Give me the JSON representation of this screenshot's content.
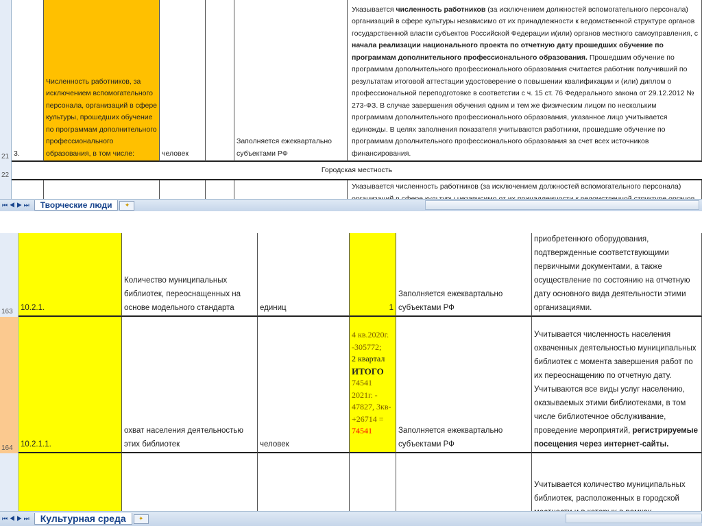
{
  "top": {
    "row21": {
      "num": "21",
      "code": "3.",
      "name": "Численность работников, за исключением вспомогательного персонала, организаций в сфере культуры, прошедших обучение по программам дополнительного профессионального образования, в том числе:",
      "unit": "человек",
      "fill": "Заполняется ежеквартально субъектами РФ",
      "desc_1": "Указывается ",
      "desc_b1": "численность работников",
      "desc_2": " (за исключением должностей вспомогательного персонала) организаций в сфере культуры независимо от их принадлежности к ведомственной структуре органов государственной власти субъектов Российской Федерации и(или) органов местного самоуправления, с ",
      "desc_b2": "начала реализации национального проекта по отчетную дату прошедших обучение по программам дополнительного профессионального образования.",
      "desc_3": " Прошедшим обучение по программам дополнительного профессионального образования считается работник получивший по результатам итоговой аттестации удостоверение о повышении квалификации и (или) диплом о профессиональной переподготовке в соответстии с ч. 15 ст. 76 Федерального закона от 29.12.2012 № 273-ФЗ. В случае завершения обучения одним и тем же физическим лицом по нескольким программам дополнительного профессионального образования, указанное лицо учитывается единожды. В целях заполнения показателя учитываются работники, прошедшие обучение по программам дополнительного профессионального образования за счет всех источников финансирования."
    },
    "row22": {
      "num": "22",
      "text": "Городская местность"
    },
    "row23": {
      "desc": "Указывается численность работников (за исключением должностей вспомогательного персонала) организаций в сфере культуры независимо от их принадлежности к ведомственной структуре органов"
    },
    "sheet_tab": "Творческие люди"
  },
  "bottom": {
    "row162": {
      "desc": "служит приемка выполненных работ и приобретенного оборудования, подтвержденные соответствующими первичными документами, а также осуществление по состоянию на отчетную дату основного вида деятельности этими организациями."
    },
    "row163": {
      "num": "163",
      "code": "10.2.1.",
      "name": "Количество муниципальных библиотек, переоснащенных на основе модельного стандарта",
      "unit": "единиц",
      "value": "1",
      "fill": "Заполняется ежеквартально субъектами РФ"
    },
    "row164": {
      "num": "164",
      "code": "10.2.1.1.",
      "name": "охват населения деятельностью этих библиотек",
      "unit": "человек",
      "value_1": "4 кв.2020г. -305772;",
      "value_2": "2 квартал",
      "value_3": "ИТОГО",
      "value_4": "74541",
      "value_5": "2021г. - 47827, 3кв- +26714 =",
      "value_6": "74541",
      "fill": "Заполняется ежеквартально субъектами РФ",
      "desc": "Учитывается численность населения охваченных деятельностью муниципальных библиотек с момента завершения работ по их переоснащению по отчетную дату. Учитываются все виды услуг населению, оказываемых этими библиотеками, в том числе библиотечное обслуживание, проведение мероприятий,",
      "desc_b": "регистрируемые посещения через интернет-сайты."
    },
    "row165": {
      "desc": "Учитывается количество муниципальных библиотек, расположенных в городской местности и в которых в рамках"
    },
    "sheet_tab": "Культурная среда"
  },
  "colors": {
    "orange": "#ffc000",
    "yellow": "#ffff00",
    "red": "#ff0000"
  }
}
